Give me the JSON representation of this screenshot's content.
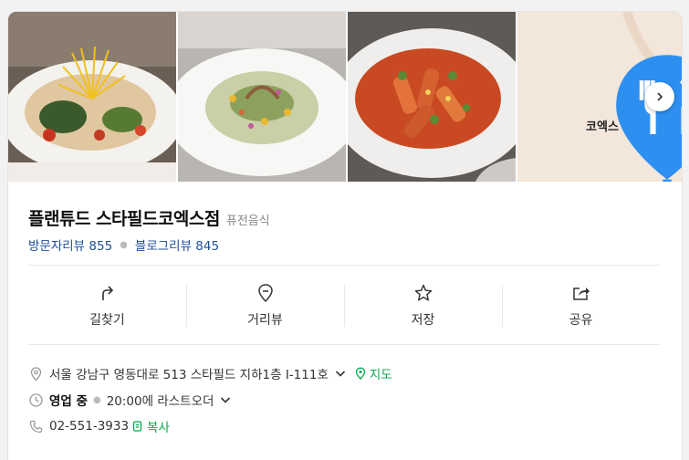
{
  "photos": {
    "items": [
      {
        "icon": "food-photo-pasta-veggie"
      },
      {
        "icon": "food-photo-cream-pasta"
      },
      {
        "icon": "food-photo-rigatoni"
      }
    ],
    "map_label": "코엑스",
    "map_icon": "restaurant-pin-icon",
    "next_icon": "chevron-right-icon"
  },
  "place": {
    "name": "플랜튜드 스타필드코엑스점",
    "category": "퓨전음식",
    "visitor_reviews": "방문자리뷰 855",
    "blog_reviews": "블로그리뷰 845"
  },
  "actions": [
    {
      "label": "길찾기",
      "icon": "directions-icon"
    },
    {
      "label": "거리뷰",
      "icon": "map-pin-icon"
    },
    {
      "label": "저장",
      "icon": "star-icon"
    },
    {
      "label": "공유",
      "icon": "share-icon"
    }
  ],
  "info": {
    "address": "서울 강남구 영동대로 513 스타필드 지하1층 I-111호",
    "map_link": "지도",
    "status": "영업 중",
    "hours": "20:00에 라스트오더",
    "phone": "02-551-3933",
    "copy_label": "복사"
  },
  "colors": {
    "link_blue": "#1f4f9b",
    "green": "#03a94d",
    "pin_blue": "#2d8ff0"
  }
}
